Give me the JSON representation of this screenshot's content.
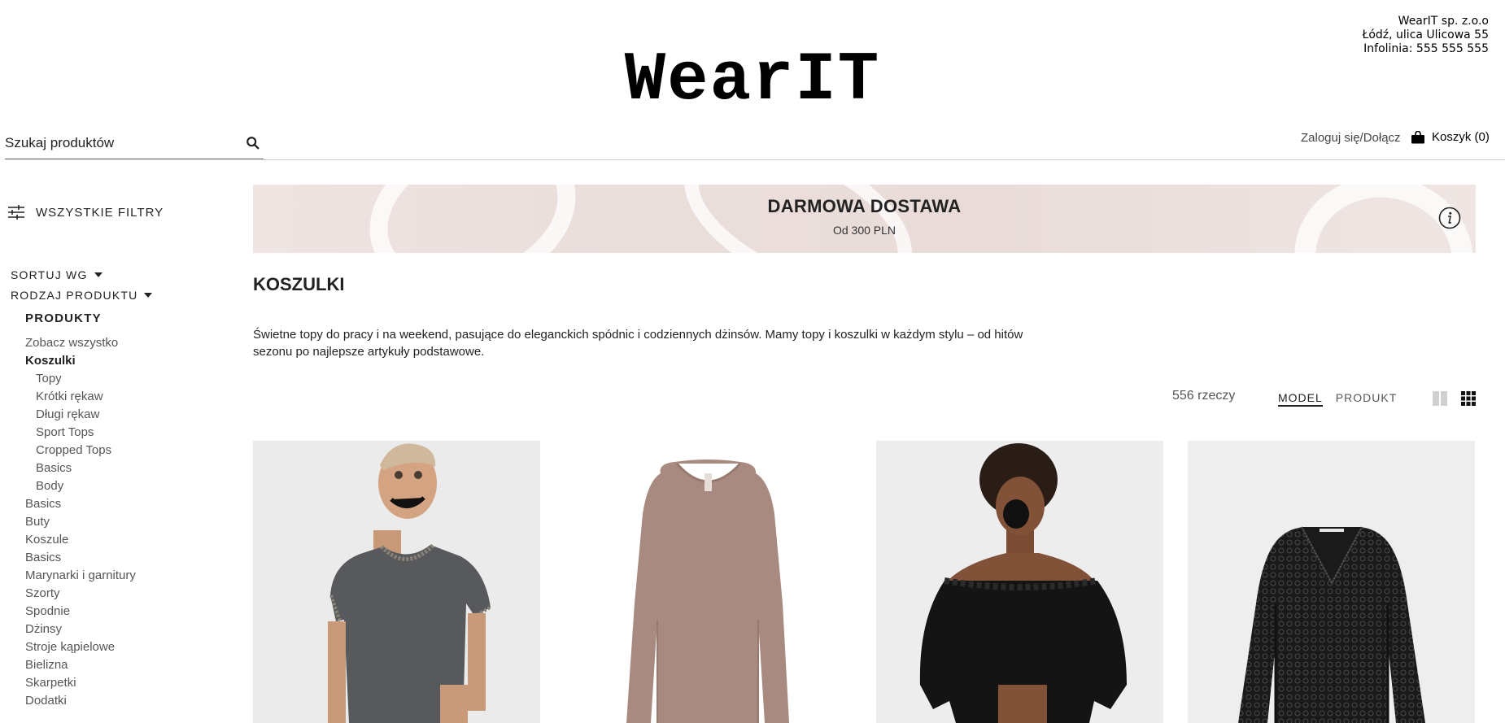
{
  "company": {
    "line1": "WearIT sp. z.o.o",
    "line2": "Łódź, ulica Ulicowa 55",
    "line3": "Infolinia: 555 555 555"
  },
  "brand": {
    "logo": "WearIT"
  },
  "search": {
    "placeholder": "Szukaj produktów",
    "icon": "search-icon"
  },
  "header": {
    "login": "Zaloguj się/Dołącz",
    "cart": "Koszyk (0)",
    "cart_icon": "shopping-bag-icon"
  },
  "sidebar": {
    "all_filters": "WSZYSTKIE FILTRY",
    "sort_by": "SORTUJ WG",
    "product_type": "RODZAJ PRODUKTU",
    "heading": "PRODUKTY",
    "items": [
      {
        "label": "Zobacz wszystko"
      },
      {
        "label": "Koszulki",
        "active": true
      },
      {
        "label": "Topy",
        "sub": true
      },
      {
        "label": "Krótki rękaw",
        "sub": true
      },
      {
        "label": "Długi rękaw",
        "sub": true
      },
      {
        "label": "Sport Tops",
        "sub": true
      },
      {
        "label": "Cropped Tops",
        "sub": true
      },
      {
        "label": "Basics",
        "sub": true
      },
      {
        "label": "Body",
        "sub": true
      },
      {
        "label": "Basics"
      },
      {
        "label": "Buty"
      },
      {
        "label": "Koszule"
      },
      {
        "label": "Basics"
      },
      {
        "label": "Marynarki i garnitury"
      },
      {
        "label": "Szorty"
      },
      {
        "label": "Spodnie"
      },
      {
        "label": "Dżinsy"
      },
      {
        "label": "Stroje kąpielowe"
      },
      {
        "label": "Bielizna"
      },
      {
        "label": "Skarpetki"
      },
      {
        "label": "Dodatki"
      }
    ]
  },
  "banner": {
    "title": "DARMOWA DOSTAWA",
    "subtitle": "Od 300 PLN",
    "icon": "info-icon"
  },
  "main": {
    "title": "KOSZULKI",
    "description": "Świetne topy do pracy i na weekend, pasujące do eleganckich spódnic i codziennych dżinsów. Mamy topy i koszulki w każdym stylu – od hitów sezonu po najlepsze artykuły podstawowe.",
    "count": "556 rzeczy",
    "view_model": "MODEL",
    "view_product": "PRODUKT"
  },
  "products": [
    {
      "name": "grey-tshirt-model",
      "color": "#58595c"
    },
    {
      "name": "beige-longsleeve",
      "color": "#a88a80"
    },
    {
      "name": "black-offshoulder-model",
      "color": "#141414"
    },
    {
      "name": "black-lace-top",
      "color": "#1a1a1a"
    }
  ]
}
